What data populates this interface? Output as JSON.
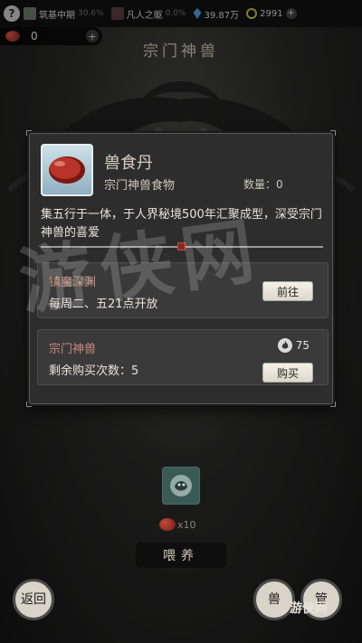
{
  "status_bar": {
    "help_label": "?",
    "realm_label": "筑基中期",
    "realm_pct": "30.6%",
    "mortal_label": "凡人之躯",
    "mortal_pct": "0.0%",
    "spirit_stones": "39.87万",
    "coins": "2991"
  },
  "pill_counter": {
    "count": "0",
    "plus": "+"
  },
  "page_title": "宗门神兽",
  "item": {
    "name": "兽食丹",
    "type": "宗门神兽食物",
    "quantity_label": "数量：0",
    "description": "集五行于一体，于人界秘境500年汇聚成型，深受宗门神兽的喜爱"
  },
  "sources": [
    {
      "title": "镇魔深渊",
      "subtitle": "每周二、五21点开放",
      "button": "前往"
    },
    {
      "title": "宗门神兽",
      "subtitle": "剩余购买次数：5",
      "price": "75",
      "button": "购买"
    }
  ],
  "bottom": {
    "food_count": "x10",
    "feed_button": "喂养",
    "back_button": "返回",
    "beast_button": "兽",
    "manage_button": "管"
  },
  "watermark": {
    "text": "游侠网",
    "logo": "游侠网"
  },
  "colors": {
    "source_title": "#c88a7a",
    "beast_slot": "#3a5a55",
    "panel_bg": "#2d2d2d"
  }
}
